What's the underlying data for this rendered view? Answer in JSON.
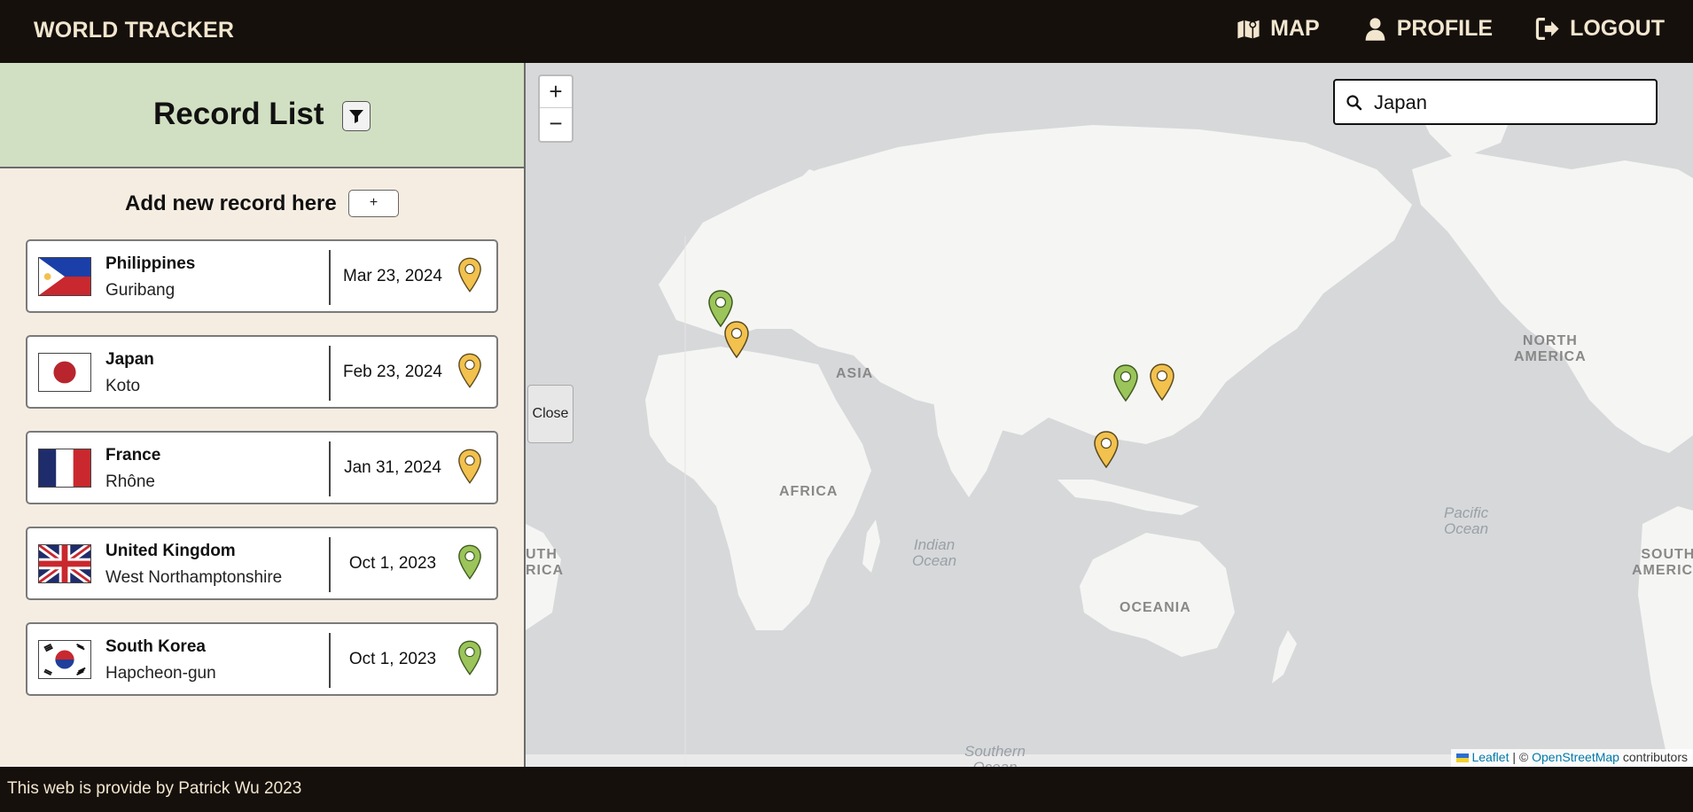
{
  "nav": {
    "brand": "WORLD TRACKER",
    "map_label": "MAP",
    "profile_label": "PROFILE",
    "logout_label": "LOGOUT"
  },
  "sidebar": {
    "title": "Record List",
    "add_label": "Add new record here",
    "add_button": "+",
    "records": [
      {
        "country": "Philippines",
        "city": "Guribang",
        "date": "Mar 23, 2024",
        "flag": "philippines-flag",
        "pin": "yellow"
      },
      {
        "country": "Japan",
        "city": "Koto",
        "date": "Feb 23, 2024",
        "flag": "japan-flag",
        "pin": "yellow"
      },
      {
        "country": "France",
        "city": "Rhône",
        "date": "Jan 31, 2024",
        "flag": "france-flag",
        "pin": "yellow"
      },
      {
        "country": "United Kingdom",
        "city": "West Northamptonshire",
        "date": "Oct 1, 2023",
        "flag": "uk-flag",
        "pin": "green"
      },
      {
        "country": "South Korea",
        "city": "Hapcheon-gun",
        "date": "Oct 1, 2023",
        "flag": "south-korea-flag",
        "pin": "green"
      }
    ]
  },
  "map": {
    "zoom_in": "+",
    "zoom_out": "−",
    "close_label": "Close",
    "search_value": "Japan",
    "attribution": {
      "leaflet": "Leaflet",
      "sep": " | © ",
      "osm": "OpenStreetMap",
      "suffix": " contributors"
    },
    "labels": {
      "asia": "ASIA",
      "africa": "AFRICA",
      "oceania": "OCEANIA",
      "north_america_1": "NORTH",
      "north_america_2": "AMERICA",
      "south_america_left_1": "UTH",
      "south_america_left_2": "RICA",
      "south_america_right_1": "SOUTH",
      "south_america_right_2": "AMERICA",
      "indian_ocean_1": "Indian",
      "indian_ocean_2": "Ocean",
      "pacific_ocean_1": "Pacific",
      "pacific_ocean_2": "Ocean",
      "southern_ocean_1": "Southern",
      "southern_ocean_2": "Ocean"
    }
  },
  "colors": {
    "pin_yellow": "#f2c14e",
    "pin_green": "#9bc45a",
    "header_green": "#d1e0c2",
    "sidebar_bg": "#f6ede2",
    "nav_bg": "#15100c"
  },
  "footer": {
    "text": "This web is provide by Patrick Wu 2023"
  }
}
